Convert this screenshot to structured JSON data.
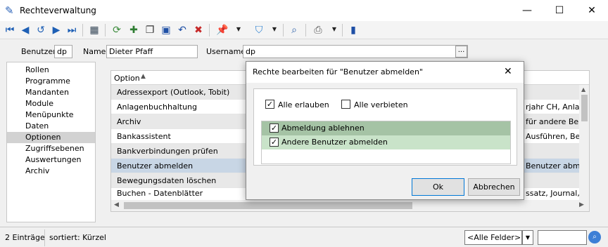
{
  "window": {
    "title": "Rechteverwaltung",
    "minimize": "—",
    "maximize": "☐",
    "close": "✕"
  },
  "header": {
    "benutzer_label": "Benutzer",
    "benutzer_value": "dp",
    "name_label": "Name",
    "name_value": "Dieter Pfaff",
    "username_label": "Username",
    "username_value": "dp",
    "browse_label": "..."
  },
  "nav": {
    "items": [
      "Rollen",
      "Programme",
      "Mandanten",
      "Module",
      "Menüpunkte",
      "Daten",
      "Optionen",
      "Zugriffsebenen",
      "Auswertungen",
      "Archiv"
    ],
    "selected": "Optionen"
  },
  "grid": {
    "column_header": "Option",
    "rows": [
      {
        "label": "Adressexport (Outlook, Tobit)",
        "right": ""
      },
      {
        "label": "Anlagenbuchhaltung",
        "right": "rjahr CH, Anlage"
      },
      {
        "label": "Archiv",
        "right": "für andere Benut"
      },
      {
        "label": "Bankassistent",
        "right": "Ausführen, Bea"
      },
      {
        "label": "Bankverbindungen prüfen",
        "right": ""
      },
      {
        "label": "Benutzer abmelden",
        "right": "Benutzer abmel"
      },
      {
        "label": "Bewegungsdaten löschen",
        "right": ""
      },
      {
        "label": "Buchen - Datenblätter",
        "right": "ssatz, Journal, K"
      }
    ]
  },
  "dialog": {
    "title": "Rechte bearbeiten für \"Benutzer abmelden\"",
    "close": "✕",
    "allow_all": "Alle erlauben",
    "deny_all": "Alle verbieten",
    "items": [
      "Abmeldung ablehnen",
      "Andere Benutzer abmelden"
    ],
    "ok": "Ok",
    "cancel": "Abbrechen"
  },
  "status": {
    "count": "2 Einträge",
    "sort": "sortiert: Kürzel",
    "filter_combo": "<Alle Felder>"
  },
  "colors": {
    "accent": "#2a62b8",
    "grid_selected": "#c8d6e5",
    "dlg_row1": "#a5c3a5",
    "dlg_row2": "#c9e3c9"
  }
}
